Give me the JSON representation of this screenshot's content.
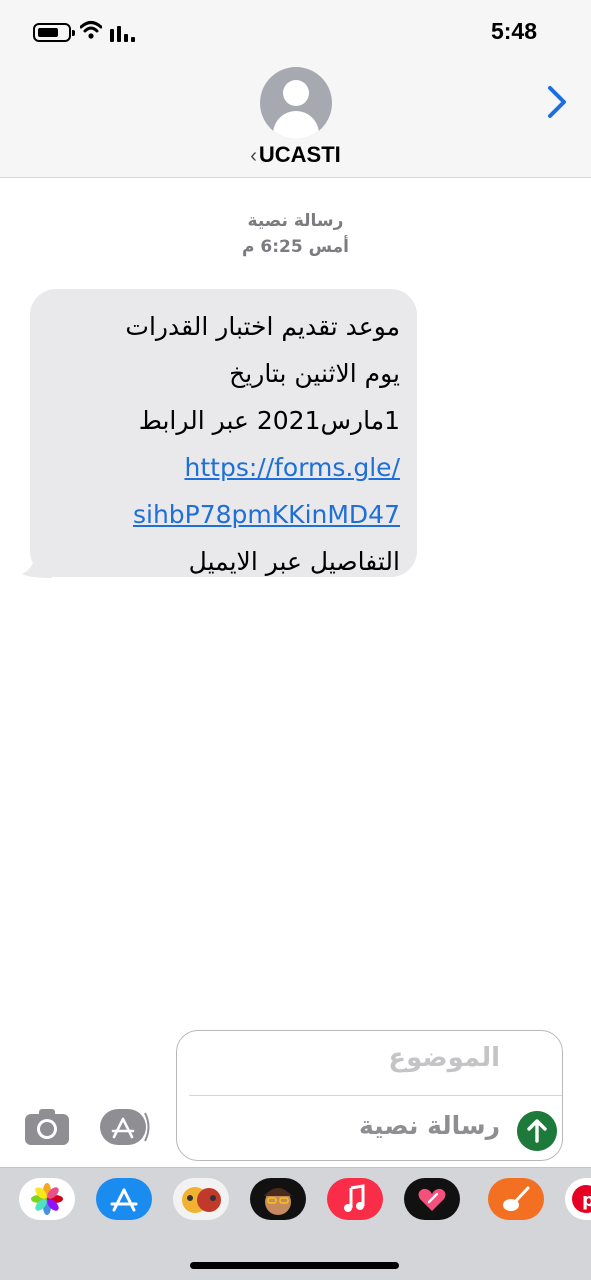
{
  "status_bar": {
    "time": "5:48",
    "icons": [
      "battery-icon",
      "wifi-icon",
      "cellular-signal-icon"
    ]
  },
  "header": {
    "contact_name": "UCASTI",
    "back_chevron": "‹",
    "avatar_icon": "person-icon",
    "details_icon": "chevron-right-icon",
    "accent_color": "#1c6ee0"
  },
  "conversation": {
    "message_type": "رسالة نصية",
    "timestamp": "أمس 6:25 م",
    "message": {
      "line1": "موعد تقديم اختبار القدرات",
      "line2": "يوم الاثنين  بتاريخ",
      "line3": "1مارس2021 عبر الرابط",
      "link_part1": "https://forms.gle/",
      "link_part2": "sihbP78pmKKinMD47",
      "line4": "التفاصيل عبر الايميل",
      "bubble_color": "#e9e9eb",
      "link_color": "#1e6fd9"
    }
  },
  "compose": {
    "subject_placeholder": "الموضوع",
    "message_placeholder": "رسالة نصية",
    "send_icon": "arrow-up-icon",
    "send_color": "#1e7a3a",
    "camera_icon": "camera-icon",
    "appstore_icon": "app-store-icon"
  },
  "app_drawer": {
    "apps": [
      "photos-icon",
      "app-store-icon",
      "animoji-icon",
      "memoji-icon",
      "music-icon",
      "digital-touch-icon",
      "garageband-icon",
      "pinterest-icon"
    ]
  }
}
